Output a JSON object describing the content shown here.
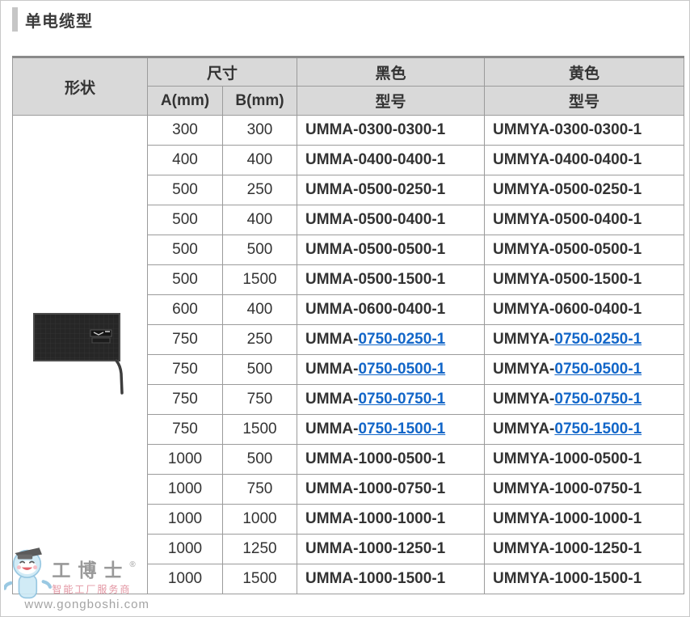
{
  "page": {
    "title": "单电缆型"
  },
  "colors": {
    "header_bg": "#d9d9d9",
    "border": "#9b9b9b",
    "border_top": "#8a8a8a",
    "text": "#333333",
    "link": "#1266c8",
    "title_bar": "#c6c6c6"
  },
  "table": {
    "headers": {
      "shape": "形状",
      "size": "尺寸",
      "dim_a": "A(mm)",
      "dim_b": "B(mm)",
      "black": "黑色",
      "yellow": "黄色",
      "black_model": "型号",
      "yellow_model": "型号"
    },
    "rows": [
      {
        "a": "300",
        "b": "300",
        "black_prefix": "UMMA-",
        "black_code": "0300-0300-1",
        "yellow_prefix": "UMMYA-",
        "yellow_code": "0300-0300-1",
        "link": false
      },
      {
        "a": "400",
        "b": "400",
        "black_prefix": "UMMA-",
        "black_code": "0400-0400-1",
        "yellow_prefix": "UMMYA-",
        "yellow_code": "0400-0400-1",
        "link": false
      },
      {
        "a": "500",
        "b": "250",
        "black_prefix": "UMMA-",
        "black_code": "0500-0250-1",
        "yellow_prefix": "UMMYA-",
        "yellow_code": "0500-0250-1",
        "link": false
      },
      {
        "a": "500",
        "b": "400",
        "black_prefix": "UMMA-",
        "black_code": "0500-0400-1",
        "yellow_prefix": "UMMYA-",
        "yellow_code": "0500-0400-1",
        "link": false
      },
      {
        "a": "500",
        "b": "500",
        "black_prefix": "UMMA-",
        "black_code": "0500-0500-1",
        "yellow_prefix": "UMMYA-",
        "yellow_code": "0500-0500-1",
        "link": false
      },
      {
        "a": "500",
        "b": "1500",
        "black_prefix": "UMMA-",
        "black_code": "0500-1500-1",
        "yellow_prefix": "UMMYA-",
        "yellow_code": "0500-1500-1",
        "link": false
      },
      {
        "a": "600",
        "b": "400",
        "black_prefix": "UMMA-",
        "black_code": "0600-0400-1",
        "yellow_prefix": "UMMYA-",
        "yellow_code": "0600-0400-1",
        "link": false
      },
      {
        "a": "750",
        "b": "250",
        "black_prefix": "UMMA-",
        "black_code": "0750-0250-1",
        "yellow_prefix": "UMMYA-",
        "yellow_code": "0750-0250-1",
        "link": true
      },
      {
        "a": "750",
        "b": "500",
        "black_prefix": "UMMA-",
        "black_code": "0750-0500-1",
        "yellow_prefix": "UMMYA-",
        "yellow_code": "0750-0500-1",
        "link": true
      },
      {
        "a": "750",
        "b": "750",
        "black_prefix": "UMMA-",
        "black_code": "0750-0750-1",
        "yellow_prefix": "UMMYA-",
        "yellow_code": "0750-0750-1",
        "link": true
      },
      {
        "a": "750",
        "b": "1500",
        "black_prefix": "UMMA-",
        "black_code": "0750-1500-1",
        "yellow_prefix": "UMMYA-",
        "yellow_code": "0750-1500-1",
        "link": true
      },
      {
        "a": "1000",
        "b": "500",
        "black_prefix": "UMMA-",
        "black_code": "1000-0500-1",
        "yellow_prefix": "UMMYA-",
        "yellow_code": "1000-0500-1",
        "link": false
      },
      {
        "a": "1000",
        "b": "750",
        "black_prefix": "UMMA-",
        "black_code": "1000-0750-1",
        "yellow_prefix": "UMMYA-",
        "yellow_code": "1000-0750-1",
        "link": false
      },
      {
        "a": "1000",
        "b": "1000",
        "black_prefix": "UMMA-",
        "black_code": "1000-1000-1",
        "yellow_prefix": "UMMYA-",
        "yellow_code": "1000-1000-1",
        "link": false
      },
      {
        "a": "1000",
        "b": "1250",
        "black_prefix": "UMMA-",
        "black_code": "1000-1250-1",
        "yellow_prefix": "UMMYA-",
        "yellow_code": "1000-1250-1",
        "link": false
      },
      {
        "a": "1000",
        "b": "1500",
        "black_prefix": "UMMA-",
        "black_code": "1000-1500-1",
        "yellow_prefix": "UMMYA-",
        "yellow_code": "1000-1500-1",
        "link": false
      }
    ]
  },
  "watermark": {
    "brand": "工博士",
    "registered": "®",
    "tagline": "智能工厂服务商",
    "url": "www.gongboshi.com"
  }
}
